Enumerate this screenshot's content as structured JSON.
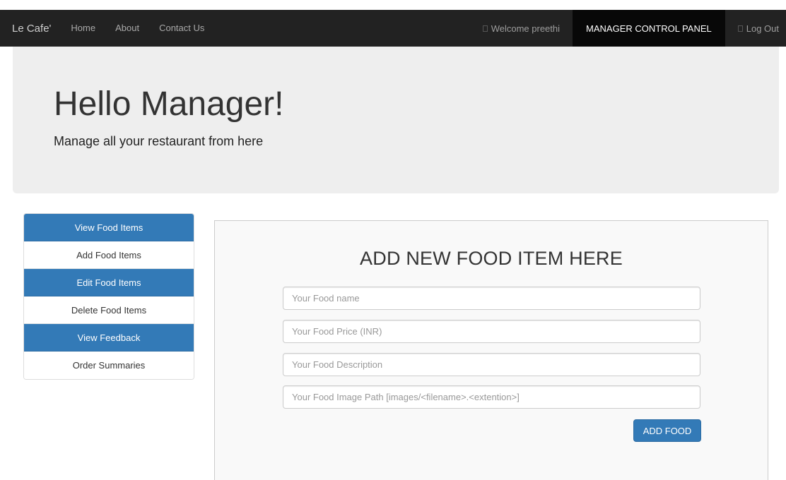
{
  "navbar": {
    "brand": "Le Cafe'",
    "links": [
      {
        "label": "Home"
      },
      {
        "label": "About"
      },
      {
        "label": "Contact Us"
      }
    ],
    "welcome": "Welcome preethi",
    "control_panel": "MANAGER CONTROL PANEL",
    "logout": "Log Out"
  },
  "jumbotron": {
    "title": "Hello Manager!",
    "subtitle": "Manage all your restaurant from here"
  },
  "side_menu": {
    "items": [
      {
        "label": "View Food Items",
        "active": true
      },
      {
        "label": "Add Food Items",
        "active": false
      },
      {
        "label": "Edit Food Items",
        "active": true
      },
      {
        "label": "Delete Food Items",
        "active": false
      },
      {
        "label": "View Feedback",
        "active": true
      },
      {
        "label": "Order Summaries",
        "active": false
      }
    ]
  },
  "form": {
    "heading": "ADD NEW FOOD ITEM HERE",
    "name_placeholder": "Your Food name",
    "price_placeholder": "Your Food Price (INR)",
    "description_placeholder": "Your Food Description",
    "image_placeholder": "Your Food Image Path [images/<filename>.<extention>]",
    "submit_label": "ADD FOOD"
  },
  "colors": {
    "navbar_bg": "#222222",
    "primary": "#337ab7",
    "jumbotron_bg": "#eeeeee"
  }
}
